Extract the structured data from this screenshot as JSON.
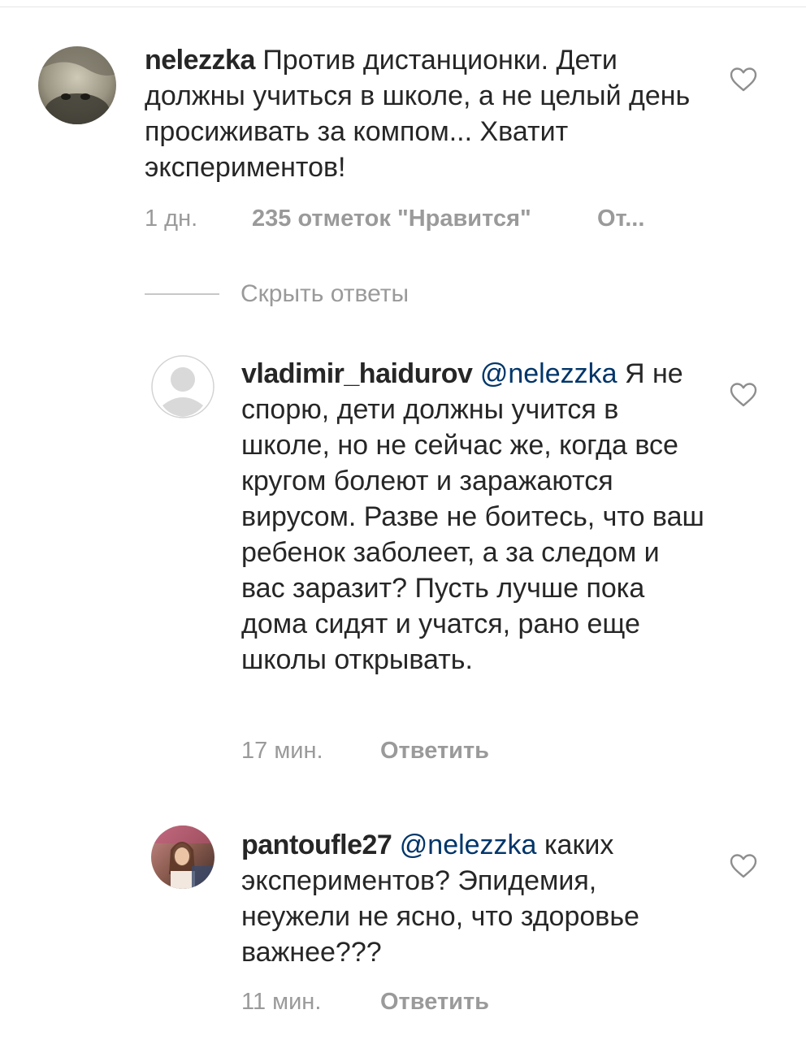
{
  "comments": {
    "main": {
      "username": "nelezzka",
      "text": "Против дистанционки. Дети должны учиться в школе, а не целый день просиживать за компом... Хватит экспериментов!",
      "time": "1 дн.",
      "likes": "235 отметок \"Нравится\"",
      "reply_label": "От..."
    },
    "hide_replies_label": "Скрыть ответы",
    "replies": [
      {
        "username": "vladimir_haidurov",
        "mention": "@nelezzka",
        "text": "Я не спорю, дети должны учится в школе, но не сейчас же, когда все кругом болеют и заражаются вирусом. Разве не боитесь, что ваш ребенок заболеет, а за следом и вас заразит? Пусть лучше пока дома сидят и учатся, рано еще школы открывать.",
        "time": "17 мин.",
        "reply_label": "Ответить"
      },
      {
        "username": "pantoufle27",
        "mention": "@nelezzka",
        "text": "каких экспериментов? Эпидемия, неужели не ясно, что здоровье важнее???",
        "time": "11 мин.",
        "reply_label": "Ответить"
      }
    ]
  },
  "icons": {
    "like": "heart-outline-icon",
    "default_avatar": "default-avatar-icon"
  },
  "colors": {
    "text": "#262626",
    "mention": "#003569",
    "meta": "#999999",
    "divider": "#c7c7c7"
  }
}
